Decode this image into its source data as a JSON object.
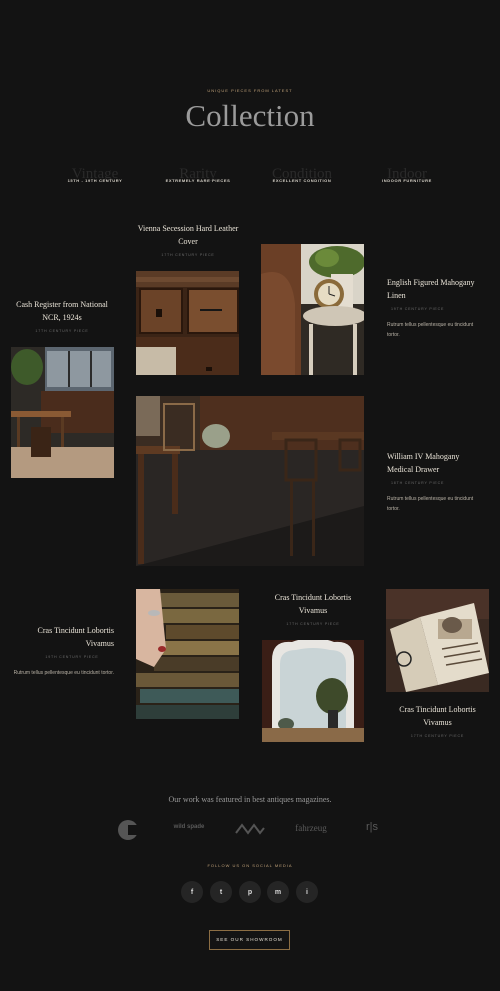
{
  "header": {
    "eyebrow": "Unique pieces from latest",
    "title": "Collection"
  },
  "features": [
    {
      "ghost": "Vintage",
      "label": "15th - 19th century"
    },
    {
      "ghost": "Rarity",
      "label": "Extremely rare pieces"
    },
    {
      "ghost": "Condition",
      "label": "Excellent condition"
    },
    {
      "ghost": "Indoor",
      "label": "Indoor furniture"
    }
  ],
  "products": [
    {
      "title": "Vienna Secession Hard Leather Cover",
      "sub": "17th century piece"
    },
    {
      "title": "English Figured Mahogany Linen",
      "sub": "19th century piece",
      "desc": "Rutrum tellus pellentesque eu tincidunt tortor."
    },
    {
      "title": "Cash Register from National NCR, 1924s",
      "sub": "17th century piece"
    },
    {
      "title": "William IV Mahogany Medical Drawer",
      "sub": "18th century piece",
      "desc": "Rutrum tellus pellentesque eu tincidunt tortor."
    },
    {
      "title": "Cras Tincidunt Lobortis Vivamus",
      "sub": "17th century piece"
    },
    {
      "title": "Cras Tincidunt Lobortis Vivamus",
      "sub": "19th century piece",
      "desc": "Rutrum tellus pellentesque eu tincidunt tortor."
    },
    {
      "title": "Cras Tincidunt Lobortis Vivamus",
      "sub": "17th century piece"
    }
  ],
  "press": {
    "heading": "Our work was featured in best antiques magazines.",
    "logos": [
      "c",
      "wild spade",
      "mw",
      "fahrzeug",
      "r|s"
    ]
  },
  "social": {
    "label": "Follow us on social media",
    "icons": [
      "f",
      "t",
      "p",
      "m",
      "i"
    ]
  },
  "cta": {
    "label": "See our showroom"
  },
  "colors": {
    "background": "#131313",
    "accent": "#c2a37a",
    "button_border": "#8c6e44"
  }
}
